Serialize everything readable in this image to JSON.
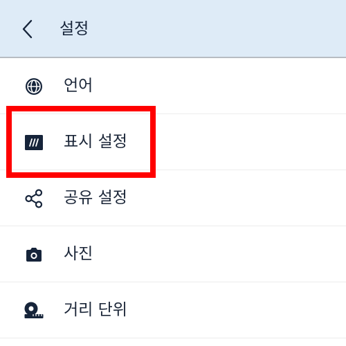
{
  "header": {
    "title": "설정",
    "back_icon": "chevron-left-icon",
    "background": "#deebf7"
  },
  "items": [
    {
      "label": "언어",
      "icon": "globe-icon"
    },
    {
      "label": "표시 설정",
      "icon": "display-icon"
    },
    {
      "label": "공유 설정",
      "icon": "share-icon"
    },
    {
      "label": "사진",
      "icon": "camera-icon"
    },
    {
      "label": "거리 단위",
      "icon": "tape-measure-icon"
    }
  ],
  "highlight": {
    "target": "표시 설정",
    "color": "#ff0000"
  },
  "colors": {
    "text": "#1b2638",
    "icon": "#16243a"
  }
}
